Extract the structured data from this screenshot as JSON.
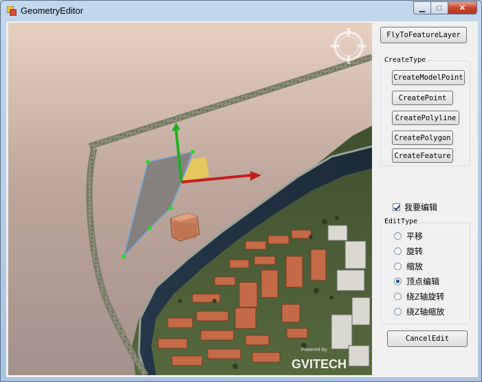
{
  "window": {
    "title": "GeometryEditor"
  },
  "buttons": {
    "fly": "FlyToFeatureLayer",
    "cancel": "CancelEdit"
  },
  "create_group": {
    "label": "CreateType",
    "buttons": [
      "CreateModelPoint",
      "CreatePoint",
      "CreatePolyline",
      "CreatePolygon",
      "CreateFeature"
    ]
  },
  "edit_checkbox": {
    "label": "我要编辑",
    "checked": true
  },
  "edit_group": {
    "label": "EditType",
    "options": [
      "平移",
      "旋转",
      "缩放",
      "顶点编辑",
      "绕Z轴旋转",
      "绕Z轴缩放"
    ],
    "selected": "顶点编辑"
  },
  "viewport": {
    "watermark_small": "Powered By",
    "watermark_logo": "GVITECH"
  }
}
